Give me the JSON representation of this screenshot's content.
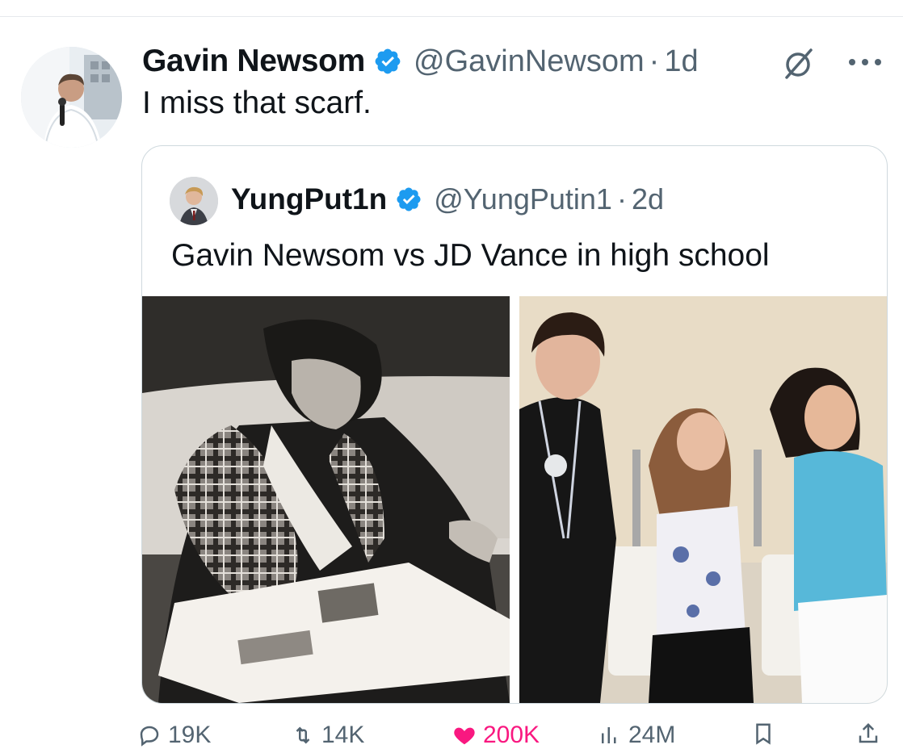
{
  "tweet": {
    "author_name": "Gavin Newsom",
    "handle": "@GavinNewsom",
    "separator": "·",
    "time": "1d",
    "text": "I miss that scarf."
  },
  "quoted_tweet": {
    "author_name": "YungPut1n",
    "handle": "@YungPutin1",
    "separator": "·",
    "time": "2d",
    "text": "Gavin Newsom vs JD Vance in high school"
  },
  "actions": {
    "replies": "19K",
    "reposts": "14K",
    "likes": "200K",
    "views": "24M"
  },
  "colors": {
    "verified_badge": "#1d9bf0",
    "secondary_text": "#536471",
    "like": "#f91880",
    "border": "#cfd9de"
  },
  "icons": [
    "verified-badge-icon",
    "grok-icon",
    "more-icon",
    "reply-icon",
    "repost-icon",
    "like-icon",
    "views-icon",
    "bookmark-icon",
    "share-icon"
  ]
}
